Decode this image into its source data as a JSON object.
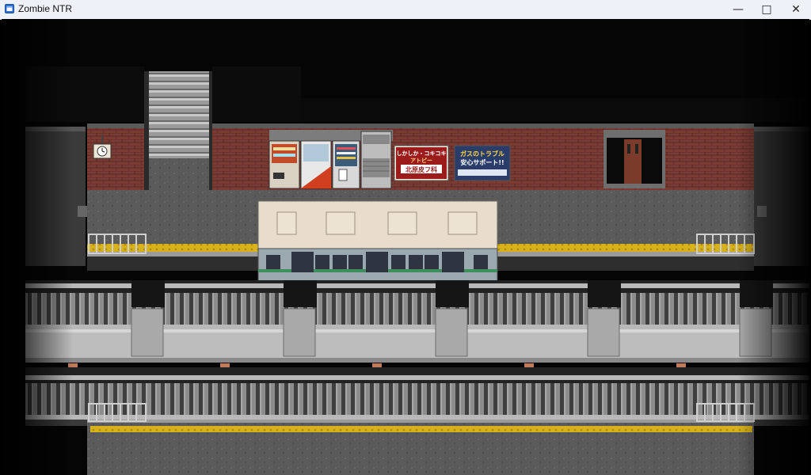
{
  "window": {
    "title": "Zombie NTR",
    "minimize_label": "—",
    "maximize_label": "□",
    "close_label": "✕"
  },
  "scene": {
    "poster_left": {
      "line1": "しかしか・コキコキ",
      "line2": "アトピー",
      "line3": "北原皮フ科"
    },
    "poster_right": {
      "line1": "ガスのトラブル",
      "line2": "安心サポート!!"
    }
  },
  "colors": {
    "brick": "#7a3b33",
    "platform_stripe": "#d8b21c",
    "train_roof": "#e8ddcc",
    "train_body": "#9aa9b0",
    "train_stripe": "#3e8f5c"
  }
}
